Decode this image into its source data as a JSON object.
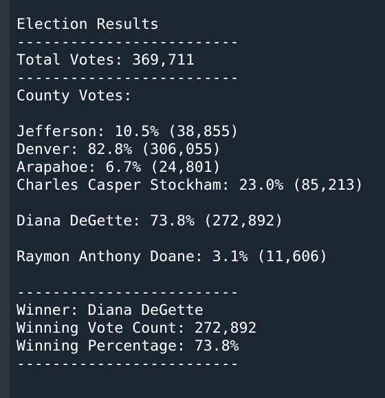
{
  "terminal": {
    "lines": [
      "Election Results",
      "-------------------------",
      "Total Votes: 369,711",
      "-------------------------",
      "County Votes:",
      "",
      "Jefferson: 10.5% (38,855)",
      "Denver: 82.8% (306,055)",
      "Arapahoe: 6.7% (24,801)",
      "Charles Casper Stockham: 23.0% (85,213)",
      "",
      "Diana DeGette: 73.8% (272,892)",
      "",
      "Raymon Anthony Doane: 3.1% (11,606)",
      "",
      "-------------------------",
      "Winner: Diana DeGette",
      "Winning Vote Count: 272,892",
      "Winning Percentage: 73.8%",
      "-------------------------"
    ]
  }
}
